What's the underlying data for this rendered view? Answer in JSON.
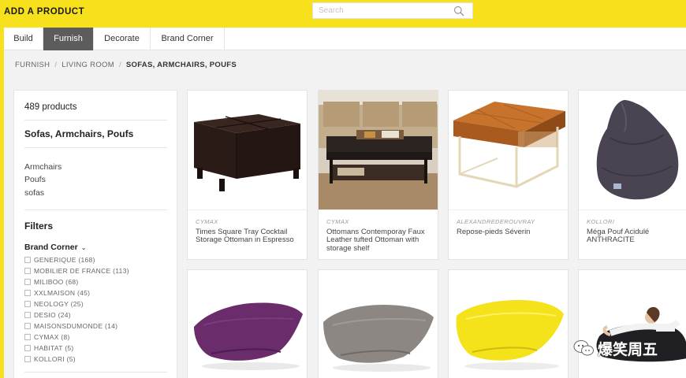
{
  "header": {
    "title": "ADD A PRODUCT",
    "search_placeholder": "Search"
  },
  "tabs": [
    {
      "label": "Build"
    },
    {
      "label": "Furnish",
      "active": true
    },
    {
      "label": "Decorate"
    },
    {
      "label": "Brand Corner"
    }
  ],
  "breadcrumb": [
    "FURNISH",
    "LIVING ROOM",
    "SOFAS, ARMCHAIRS, POUFS"
  ],
  "sidebar": {
    "product_count": "489 products",
    "category_title": "Sofas, Armchairs, Poufs",
    "subcategories": [
      "Armchairs",
      "Poufs",
      "sofas"
    ],
    "filters_title": "Filters",
    "brand_filter_title": "Brand Corner",
    "brands": [
      "GENERIQUE (168)",
      "MOBILIER DE FRANCE (113)",
      "MILIBOO (68)",
      "XXLMAISON (45)",
      "NEOLOGY (25)",
      "DESIO (24)",
      "MAISONSDUMONDE (14)",
      "CYMAX (8)",
      "HABITAT (5)",
      "KOLLORI (5)"
    ]
  },
  "products": [
    {
      "brand": "CYMAX",
      "name": "Times Square Tray Cocktail Storage Ottoman in Espresso",
      "image": "espresso-storage-ottoman"
    },
    {
      "brand": "CYMAX",
      "name": "Ottomans Contemporay Faux Leather tufted Ottoman with storage shelf",
      "image": "tufted-ottoman-living-room"
    },
    {
      "brand": "ALEXANDREDEROUVRAY",
      "name": "Repose-pieds Séverin",
      "image": "leather-footstool"
    },
    {
      "brand": "KOLLORI",
      "name": "Méga Pouf Acidulé ANTHRACITE",
      "image": "anthracite-beanbag"
    },
    {
      "brand": "",
      "name": "",
      "image": "purple-beanbag"
    },
    {
      "brand": "",
      "name": "",
      "image": "taupe-beanbag"
    },
    {
      "brand": "",
      "name": "",
      "image": "yellow-beanbag"
    },
    {
      "brand": "",
      "name": "",
      "image": "beanbag-with-woman"
    }
  ],
  "watermark": {
    "text": "爆笑周五"
  },
  "colors": {
    "accent_yellow": "#f7e11c",
    "active_tab": "#5c5c5c"
  }
}
